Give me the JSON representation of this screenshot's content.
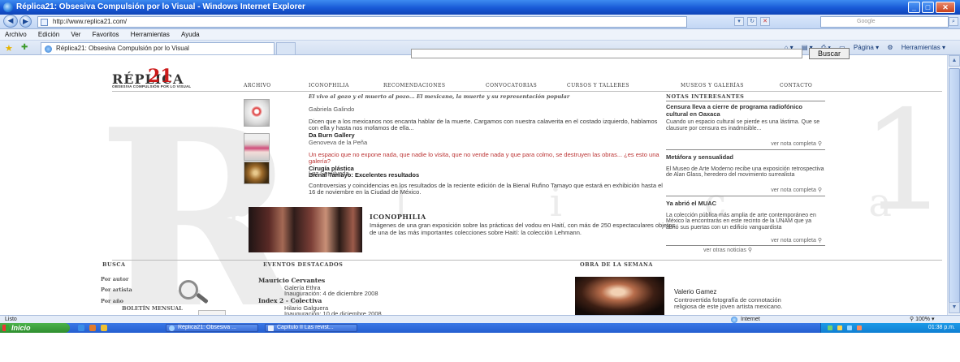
{
  "window": {
    "title": "Réplica21: Obsesiva Compulsión por lo Visual - Windows Internet Explorer",
    "min": "_",
    "max": "□",
    "close": "✕"
  },
  "address": {
    "url": "http://www.replica21.com/",
    "search_placeholder": "Google"
  },
  "menu": [
    "Archivo",
    "Edición",
    "Ver",
    "Favoritos",
    "Herramientas",
    "Ayuda"
  ],
  "tab": {
    "label": "Réplica21: Obsesiva Compulsión por lo Visual"
  },
  "commands": {
    "page": "Página",
    "tools": "Herramientas"
  },
  "site": {
    "search_button": "Buscar",
    "logo": {
      "name": "RÉPLICA",
      "num": "21",
      "tagline": "OBSESIVA COMPULSIÓN POR LO VISUAL"
    },
    "nav": [
      "ARCHIVO",
      "ICONOPHILIA",
      "RECOMENDACIONES",
      "CONVOCATORIAS",
      "CURSOS Y TALLERES",
      "MUSEOS Y GALERÍAS",
      "CONTACTO"
    ],
    "featured": {
      "title": "El vivo al gozo y el muerto al pozo... El mexicano, la muerte y su representación popular"
    },
    "articles": [
      {
        "author": "Gabriela Galindo",
        "body": "Dicen que a los mexicanos nos encanta hablar de la muerte. Cargamos con nuestra calaverita en el costado izquierdo, hablamos con ella y hasta nos mofamos de ella...",
        "next": "Da Burn Gallery"
      },
      {
        "author": "Genoveva de la Peña",
        "body": "Un espacio que no expone nada, que nadie lo visita, que no vende nada y que para colmo, se destruyen las obras... ¿es esto una galería?",
        "next": "Cirugía plástica",
        "next2": "Bienal Tamayo: Excelentes resultados"
      },
      {
        "author": "Luz Sepúlveda",
        "body": "Controversias y coincidencias en los resultados de la reciente edición de la Bienal Rufino Tamayo que estará en exhibición hasta el 16 de noviembre en la Ciudad de México."
      }
    ],
    "iconophilia": {
      "title": "ICONOPHILIA",
      "body": "Imágenes de una gran exposición sobre las prácticas del vodou en Haití, con más de 250 espectaculares objetos de una de las más importantes colecciones sobre Haití: la colección Lehmann."
    },
    "sidebar": {
      "heading": "NOTAS INTERESANTES",
      "notes": [
        {
          "title": "Censura lleva a cierre de programa radiofónico cultural en Oaxaca",
          "body": "Cuando un espacio cultural se pierde es una lástima. Que se clausure por censura es inadmisible...",
          "more": "ver nota completa"
        },
        {
          "title": "Metáfora y sensualidad",
          "body": "El Museo de Arte Moderno recibe una exposición retrospectiva de Alan Glass, heredero del movimiento surrealista",
          "more": "ver nota completa"
        },
        {
          "title": "Ya abrió el MUAC",
          "body": "La colección pública más amplia de arte contemporáneo en México la encontrarás en este recinto de la UNAM que ya abrió sus puertas con un edificio vanguardista",
          "more": "ver nota completa"
        }
      ],
      "other": "ver otras noticias"
    },
    "sections": {
      "busca": "BUSCA",
      "eventos": "EVENTOS DESTACADOS",
      "obra": "OBRA DE LA SEMANA"
    },
    "busca": {
      "autor": "Por autor",
      "artista": "Por artista",
      "anio": "Por año",
      "boletin": "BOLETÍN MENSUAL"
    },
    "events": [
      {
        "title": "Mauricio Cervantes",
        "venue": "Galería Ethra",
        "date": "Inauguración: 4 de diciembre 2008"
      },
      {
        "title": "Index 2 - Colectiva",
        "venue": "Hilario Galguera",
        "date": "Inauguración: 10 de diciembre 2008"
      }
    ],
    "obra": {
      "name": "Valerio Gamez",
      "desc": "Controvertida fotografía de connotación religiosa de este joven artista mexicano."
    },
    "watermark": {
      "r": "R",
      "letters": "p l i c a",
      "one": "1"
    }
  },
  "status": {
    "text": "Listo",
    "zone": "Internet",
    "zoom": "100%"
  },
  "taskbar": {
    "start": "Inicio",
    "tasks": [
      "Réplica21: Obsesiva ...",
      "Capítulo II Las revist..."
    ],
    "clock": "01:38 p.m."
  }
}
